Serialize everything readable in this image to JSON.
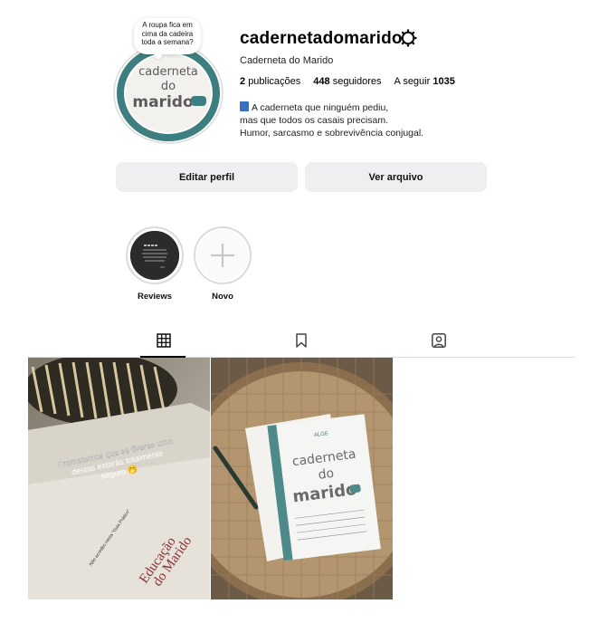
{
  "profile": {
    "username": "cadernetadomarido",
    "full_name": "Caderneta do Marido",
    "note": "A roupa fica em cima da cadeira toda a semana?",
    "avatar_text": [
      "caderneta",
      "do",
      "marido"
    ],
    "stats": {
      "posts_count": "2",
      "posts_label": "publicações",
      "followers_count": "448",
      "followers_label": "seguidores",
      "following_label": "A seguir",
      "following_count": "1035"
    },
    "bio": [
      "A caderneta que ninguém pediu,",
      "mas que todos os casais precisam.",
      "Humor, sarcasmo e sobrevivência conjugal."
    ]
  },
  "buttons": {
    "edit": "Editar perfil",
    "archive": "Ver arquivo"
  },
  "highlights": [
    {
      "label": "Reviews"
    },
    {
      "label": "Novo"
    }
  ],
  "tabs": {
    "active": "posts",
    "icons": [
      "grid-icon",
      "bookmark-icon",
      "tagged-icon"
    ]
  },
  "posts": [
    {
      "overlay": "Prometemos que se tiveres uma destas estarás totalmente seguro 🤭",
      "small_text": "Não acredito nesta \"Guia Prático\" para casais porque a sinceridade é melhor",
      "book_title": [
        "Educação",
        "do Marido"
      ]
    },
    {
      "book_title": [
        "caderneta",
        "do",
        "marido"
      ],
      "brand": "ALGE"
    }
  ],
  "colors": {
    "accent_teal": "#3d7f80",
    "button_bg": "#efeff2"
  }
}
